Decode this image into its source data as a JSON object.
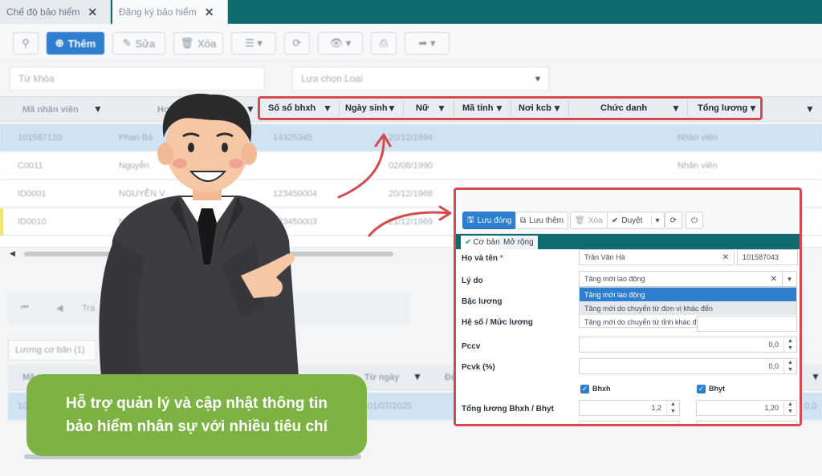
{
  "tabs": [
    {
      "label": "Chế độ bảo hiểm",
      "active": false
    },
    {
      "label": "Đăng ký bảo hiểm",
      "active": true
    }
  ],
  "toolbar": {
    "add_label": "Thêm",
    "edit_label": "Sửa",
    "delete_label": "Xóa"
  },
  "filters": {
    "keyword_placeholder": "Từ khóa",
    "type_placeholder": "Lựa chọn Loại"
  },
  "grid": {
    "columns": [
      "Mã nhân viên",
      "Họ tên",
      "Số sổ bhxh",
      "Ngày sinh",
      "Nữ",
      "Mã tỉnh",
      "Nơi kcb",
      "Chức danh",
      "Tổng lương"
    ],
    "rows": [
      {
        "ma": "101587120",
        "ten": "Phan Bá",
        "so": "14325345",
        "ngay": "20/12/1994",
        "chuc": "Nhân viên"
      },
      {
        "ma": "C0011",
        "ten": "Nguyễn",
        "so": "",
        "ngay": "02/08/1990",
        "chuc": "Nhân viên"
      },
      {
        "ma": "ID0001",
        "ten": "NGUYỄN V",
        "so": "123450004",
        "ngay": "20/12/1968",
        "chuc": ""
      },
      {
        "ma": "ID0010",
        "ten": "NG",
        "so": "123450003",
        "ngay": "21/12/1969",
        "chuc": ""
      }
    ]
  },
  "pager": {
    "text": "Tra"
  },
  "subgrid": {
    "tab_label": "Lương cơ bản (1)",
    "columns": [
      "Mã",
      "Từ ngày",
      "Đế"
    ],
    "row": {
      "ma": "10",
      "tu_ngay": "01/07/2025",
      "last": "0,0"
    }
  },
  "popup": {
    "buttons": {
      "save_close": "Lưu đóng",
      "save_more": "Lưu thêm",
      "delete": "Xóa",
      "approve": "Duyệt"
    },
    "tabs": [
      "Cơ bản",
      "Mở rộng"
    ],
    "fields": {
      "ho_ten_label": "Họ và tên",
      "ho_ten_value": "Trần Văn Hà",
      "code_value": "101587043",
      "ly_do_label": "Lý do",
      "ly_do_value": "Tăng mới lao động",
      "bac_luong_label": "Bậc lương",
      "he_so_label": "Hệ số / Mức lương",
      "pccv_label": "Pccv",
      "pccv_value": "0,0",
      "pcvk_label": "Pcvk (%)",
      "pcvk_value": "0,0",
      "bhxh_label": "Bhxh",
      "bhyt_label": "Bhyt",
      "tong_luong_label": "Tổng lương Bhxh / Bhyt",
      "tong_bhxh_value": "1,2",
      "tong_bhyt_value": "1,20"
    },
    "dropdown_options": [
      "Tăng mới lao động",
      "Tăng mới do chuyển từ đơn vị khác đến",
      "Tăng mới do chuyển từ tỉnh khác đến"
    ]
  },
  "callout": {
    "line1": "Hỗ trợ quản lý và cập nhật thông tin",
    "line2": "bảo hiểm nhân sự với nhiều tiêu chí"
  },
  "colors": {
    "accent": "#2f7fd1",
    "brand_teal": "#0f6b6e",
    "highlight_red": "#d54a4e",
    "callout_green": "#7cb342"
  }
}
